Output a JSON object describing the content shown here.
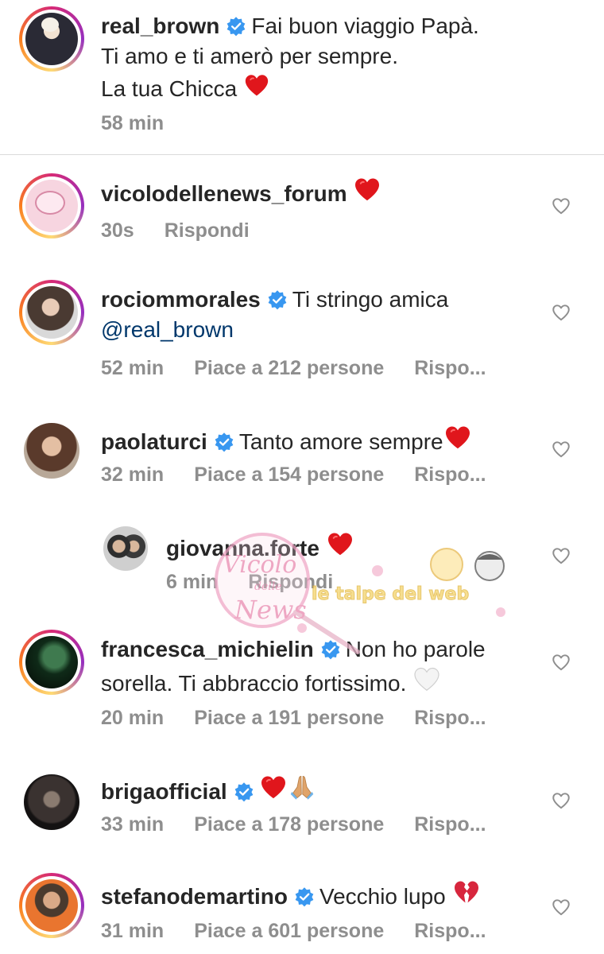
{
  "caption": {
    "username": "real_brown",
    "line1": "Fai buon viaggio Papà.",
    "line2": "Ti amo e ti amerò per sempre.",
    "line3": "La tua Chicca",
    "line3_emoji": "red-heart",
    "time": "58 min"
  },
  "comments": [
    {
      "username": "vicolodellenews_forum",
      "text": "",
      "emoji": "red-heart",
      "time": "30s",
      "reply": "Rispondi"
    },
    {
      "username": "rociommorales",
      "text": "Ti stringo amica",
      "mention": "@real_brown",
      "time": "52 min",
      "likes": "Piace a 212 persone",
      "reply": "Rispo..."
    },
    {
      "username": "paolaturci",
      "text": "Tanto amore sempre",
      "emoji": "red-heart",
      "time": "32 min",
      "likes": "Piace a 154 persone",
      "reply": "Rispo..."
    },
    {
      "username": "giovanna.forte",
      "emoji": "red-heart",
      "time": "6 min",
      "reply": "Rispondi"
    },
    {
      "username": "francesca_michielin",
      "text": "Non ho parole",
      "text2": "sorella. Ti abbraccio fortissimo.",
      "emoji": "white-heart",
      "time": "20 min",
      "likes": "Piace a 191 persone",
      "reply": "Rispo..."
    },
    {
      "username": "brigaofficial",
      "emoji": "red-heart folded-hands",
      "time": "33 min",
      "likes": "Piace a 178 persone",
      "reply": "Rispo..."
    },
    {
      "username": "stefanodemartino",
      "text": "Vecchio lupo",
      "emoji": "broken-heart",
      "time": "31 min",
      "likes": "Piace a 601 persone",
      "reply": "Rispo..."
    }
  ],
  "watermark": {
    "text": "le talpe del web",
    "logo_text_1": "Vicolo",
    "logo_text_2": "delle",
    "logo_text_3": "News"
  },
  "colors": {
    "text": "#262626",
    "meta": "#8e8e8e",
    "verified": "#3897f0",
    "mention": "#00376b",
    "heart": "#e0161c"
  }
}
